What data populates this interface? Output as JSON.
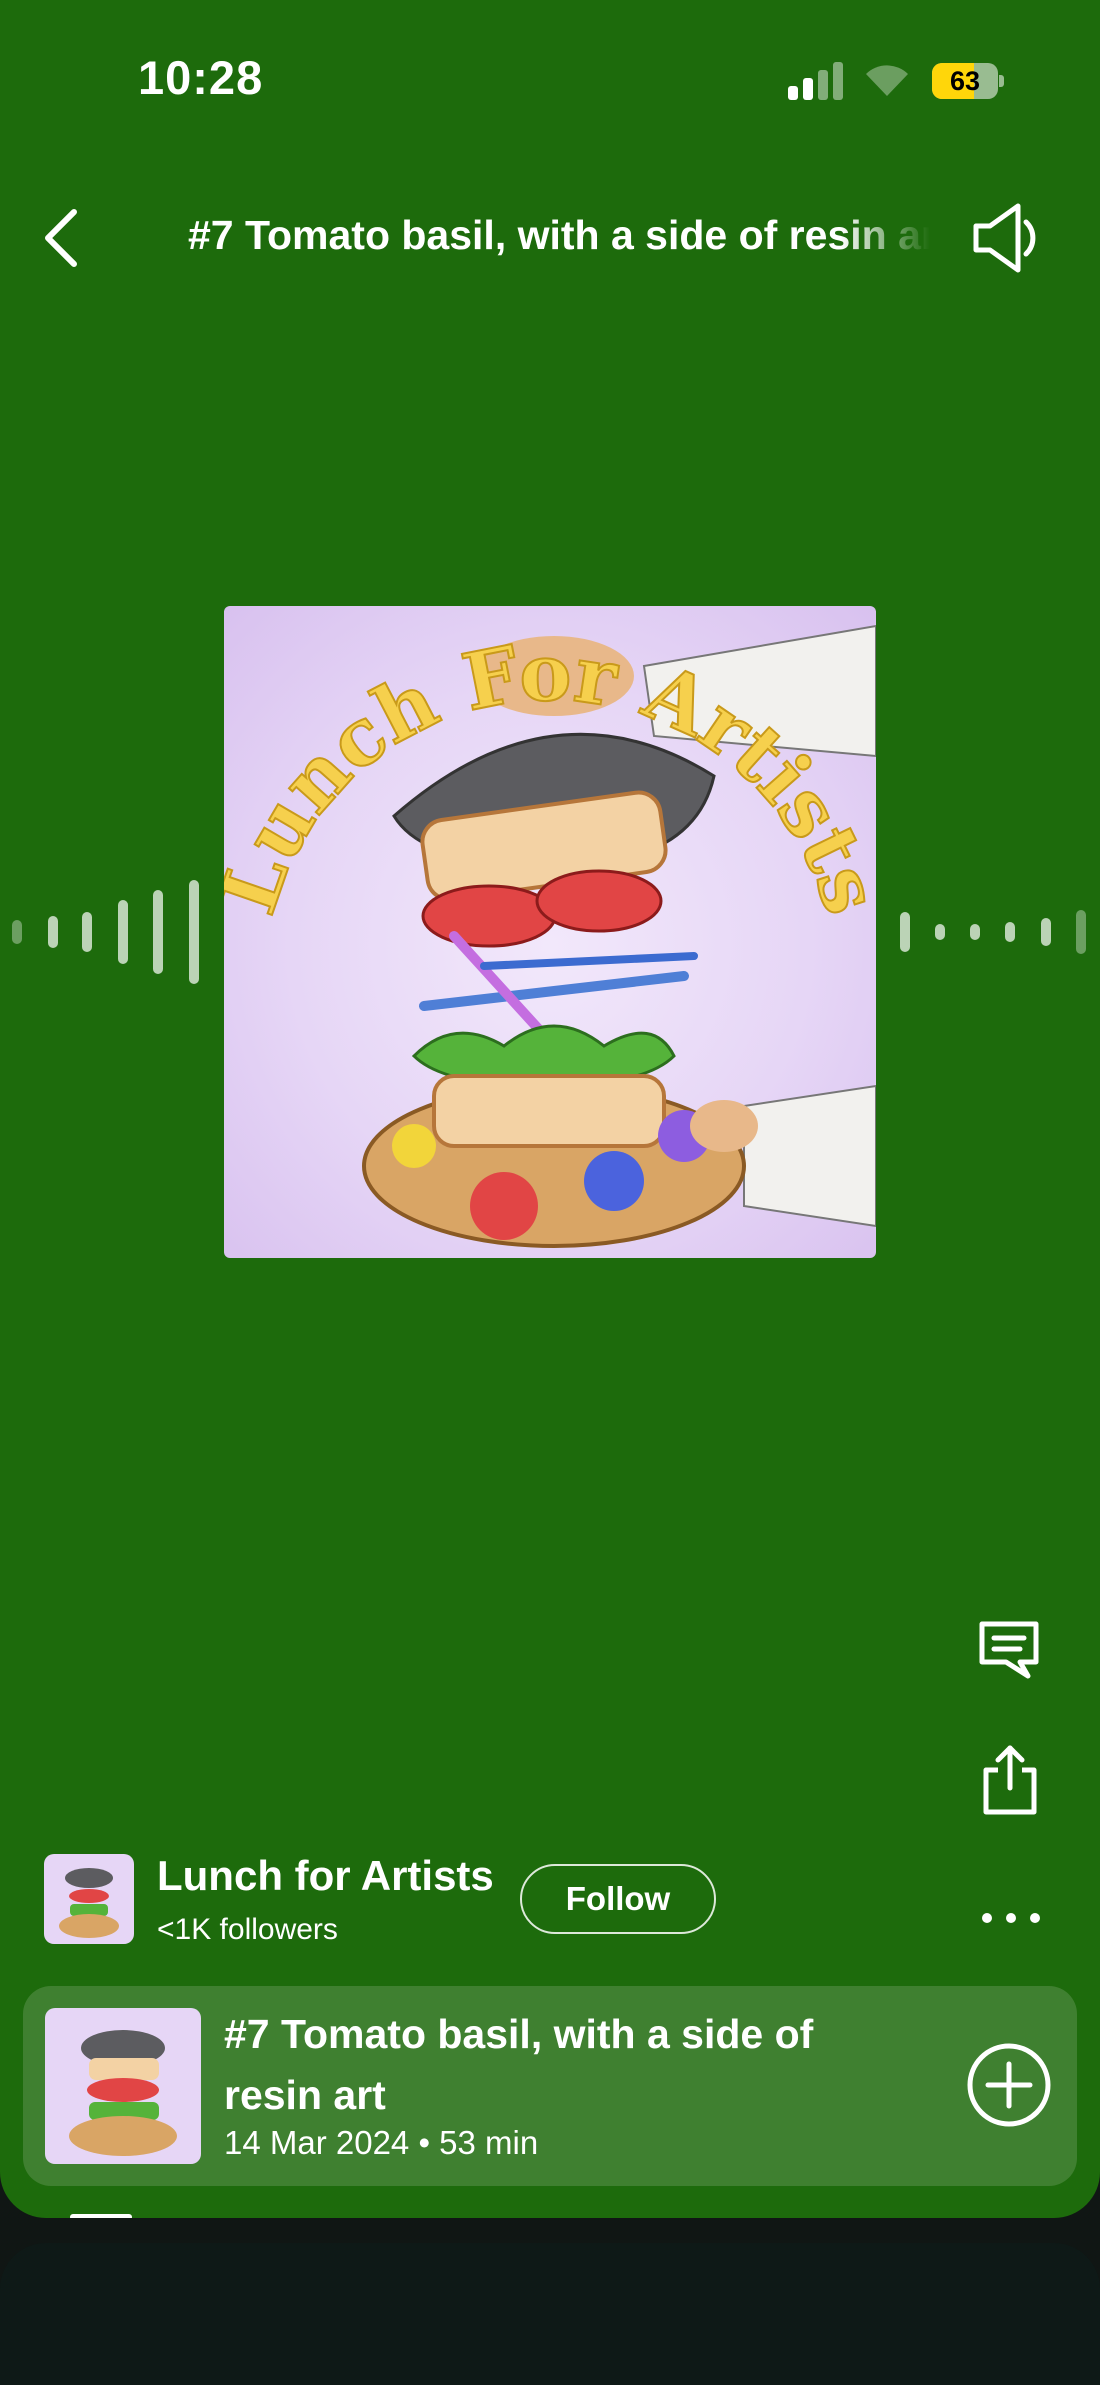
{
  "status_bar": {
    "time": "10:28",
    "battery": "63",
    "battery_level": 0.63
  },
  "header": {
    "title": "#7 Tomato basil, with a side of resin art"
  },
  "artwork": {
    "text": "Lunch For Artists"
  },
  "podcast": {
    "name": "Lunch for Artists",
    "followers": "<1K followers",
    "follow_label": "Follow"
  },
  "episode": {
    "title": "#7 Tomato basil, with a side of resin art",
    "meta": "14 Mar 2024 • 53 min"
  },
  "colors": {
    "background": "#1d6b0c",
    "card": "#3f8030",
    "bottom_sheet": "#0e1917",
    "accent_yellow": "#ffd60a"
  },
  "icons": [
    "back-icon",
    "speaker-icon",
    "comment-icon",
    "share-icon",
    "more-icon",
    "add-icon"
  ]
}
